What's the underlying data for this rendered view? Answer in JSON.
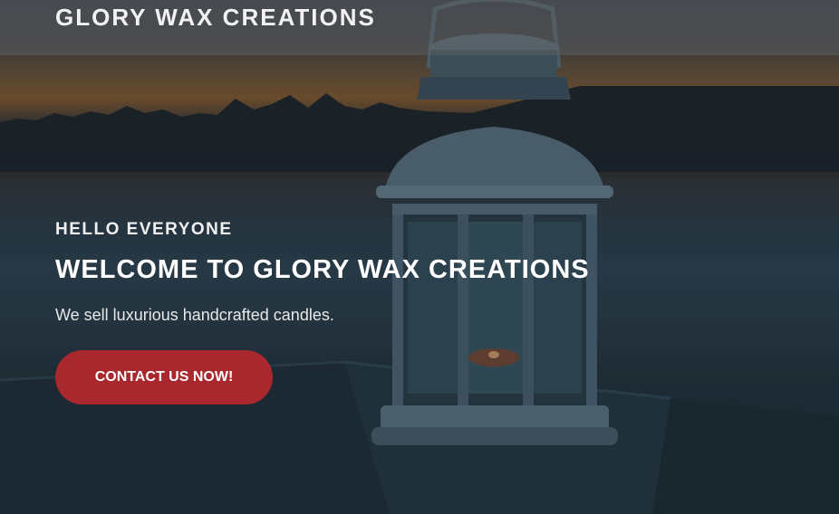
{
  "header": {
    "brand": "GLORY WAX CREATIONS"
  },
  "hero": {
    "eyebrow": "HELLO EVERYONE",
    "headline": "WELCOME TO GLORY WAX CREATIONS",
    "tagline": "We sell luxurious handcrafted candles.",
    "cta_label": "CONTACT US NOW!"
  },
  "colors": {
    "cta_background": "#a8282d",
    "text": "#ffffff"
  }
}
